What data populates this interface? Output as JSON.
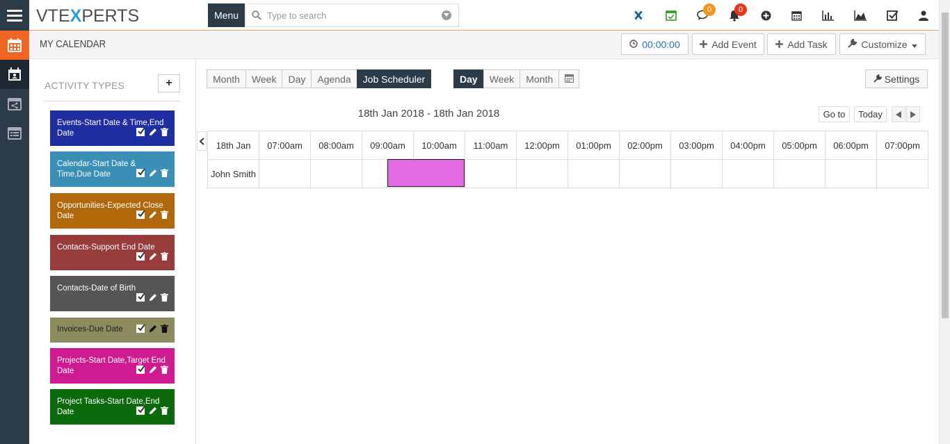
{
  "header": {
    "logo": "VTEXPERTS",
    "menu_label": "Menu",
    "search_placeholder": "Type to search",
    "chat_badge": "0",
    "notif_badge": "0"
  },
  "page": {
    "title": "MY CALENDAR",
    "timer": "00:00:00",
    "add_event": "Add Event",
    "add_task": "Add Task",
    "customize": "Customize"
  },
  "sidebar": {
    "heading": "ACTIVITY TYPES",
    "items": [
      {
        "label": "Events-Start Date & Time,End Date",
        "color": "#1f2ea0"
      },
      {
        "label": "Calendar-Start Date & Time,Due Date",
        "color": "#3a8fb6"
      },
      {
        "label": "Opportunities-Expected Close Date",
        "color": "#b0680a"
      },
      {
        "label": "Contacts-Support End Date",
        "color": "#973b3b"
      },
      {
        "label": "Contacts-Date of Birth",
        "color": "#555555"
      },
      {
        "label": "Invoices-Due Date",
        "color": "#8b8b5e"
      },
      {
        "label": "Projects-Start Date,Target End Date",
        "color": "#cf1a92"
      },
      {
        "label": "Project Tasks-Start Date,End Date",
        "color": "#0c6a0c"
      }
    ]
  },
  "views": {
    "tabs": [
      "Month",
      "Week",
      "Day",
      "Agenda",
      "Job Scheduler"
    ],
    "active_tab": "Job Scheduler",
    "sched_tabs": [
      "Day",
      "Week",
      "Month"
    ],
    "sched_active": "Day",
    "settings": "Settings"
  },
  "scheduler": {
    "range": "18th Jan 2018 - 18th Jan 2018",
    "goto": "Go to",
    "today": "Today",
    "date_col": "18th Jan",
    "slots": [
      "07:00am",
      "08:00am",
      "09:00am",
      "10:00am",
      "11:00am",
      "12:00pm",
      "01:00pm",
      "02:00pm",
      "03:00pm",
      "04:00pm",
      "05:00pm",
      "06:00pm",
      "07:00pm"
    ],
    "resource": "John Smith",
    "event_color": "#e46ae4"
  }
}
